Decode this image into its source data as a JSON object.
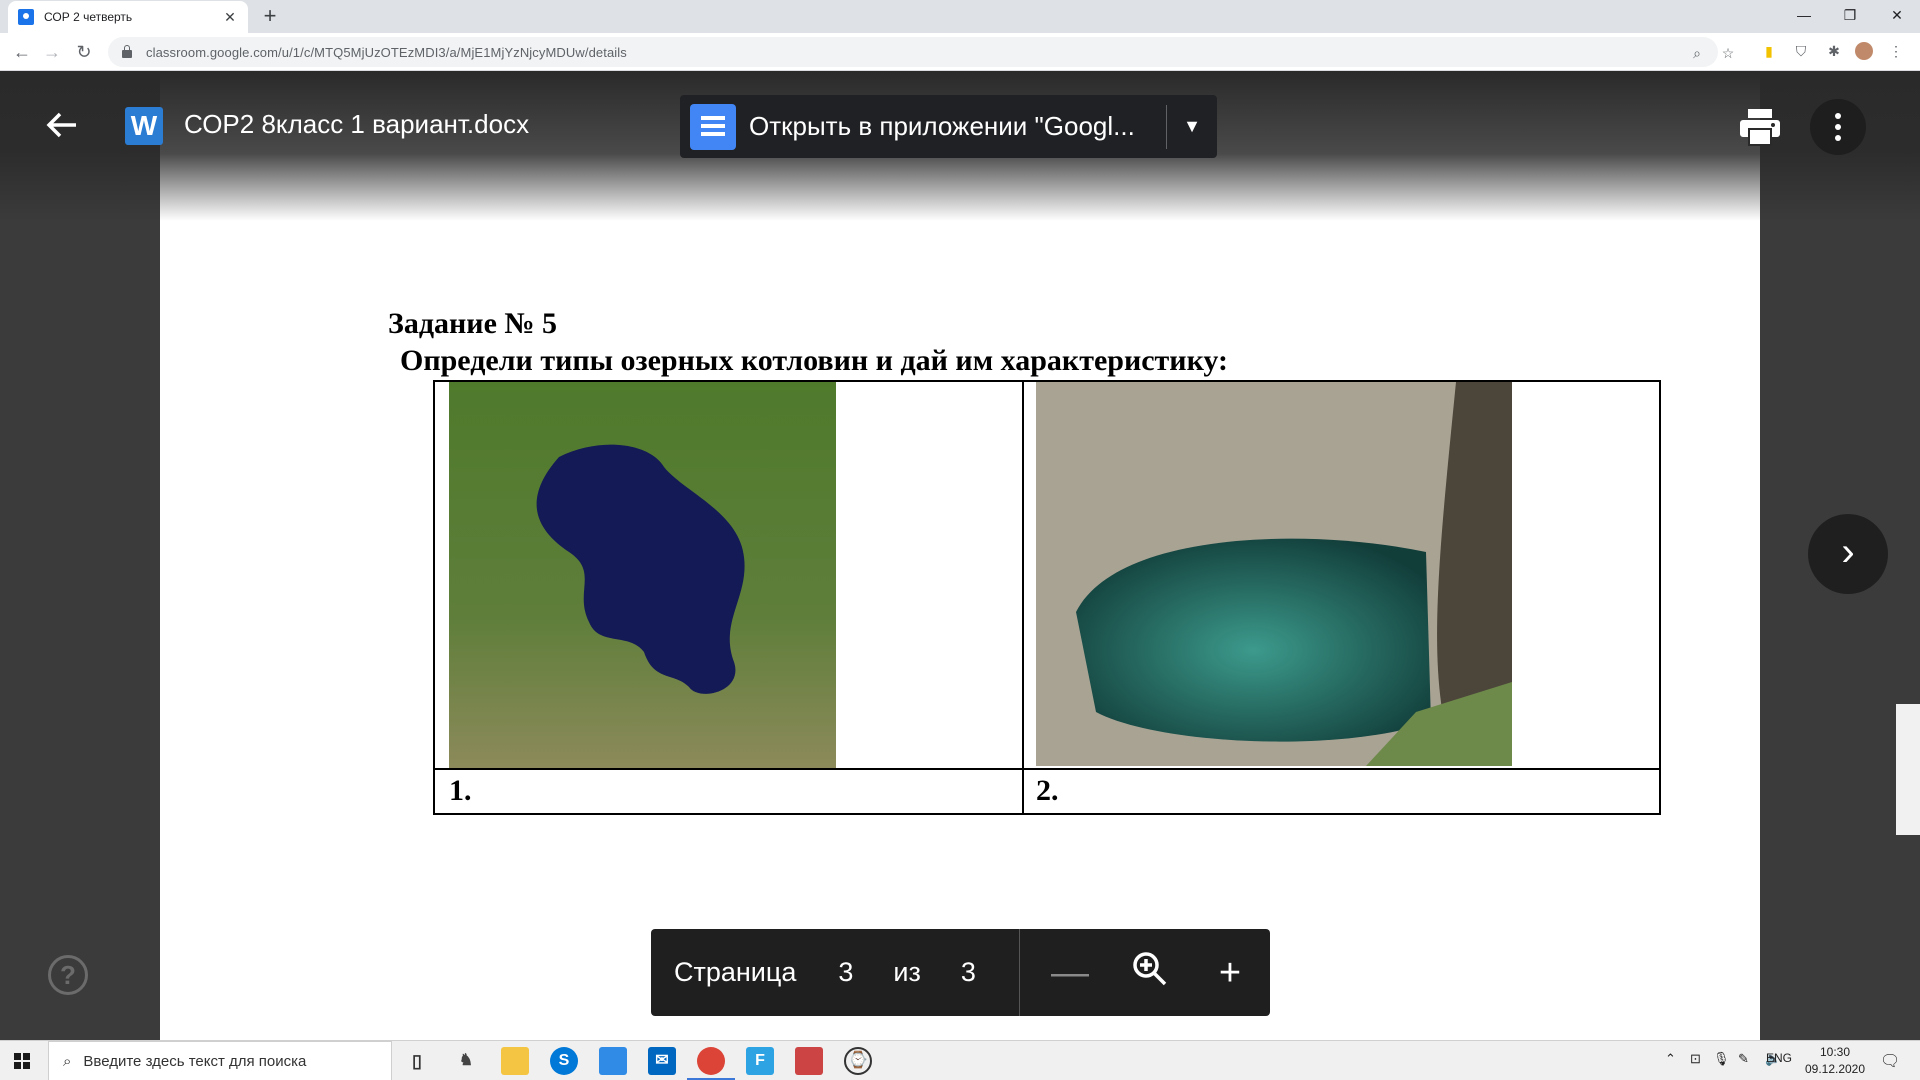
{
  "browser": {
    "tab_title": "СОР 2 четверть",
    "close_glyph": "✕",
    "new_tab_glyph": "+",
    "url": "classroom.google.com/u/1/c/MTQ5MjUzOTEzMDI3/a/MjE1MjYzNjcyMDUw/details"
  },
  "viewer": {
    "file_name": "СОР2 8класс 1 вариант.docx",
    "file_icon_letter": "W",
    "open_in_app_label": "Открыть в приложении \"Googl...",
    "help_glyph": "?",
    "next_glyph": "›"
  },
  "document": {
    "task_title": "Задание № 5",
    "task_text": "Определи типы озерных котловин и дай им характеристику:",
    "label_1": "1.",
    "label_2": "2."
  },
  "pager": {
    "page_word": "Страница",
    "current_page": "3",
    "of_word": "из",
    "total_pages": "3"
  },
  "taskbar": {
    "search_placeholder": "Введите здесь текст для поиска",
    "lang": "ENG",
    "time": "10:30",
    "date": "09.12.2020"
  },
  "icons": {
    "back": "back-arrow-icon",
    "print": "print-icon",
    "more": "more-vert-icon",
    "zoom_out": "minus-icon",
    "zoom": "zoom-icon",
    "zoom_in": "plus-icon"
  },
  "colors": {
    "viewer_bg": "#3b3b3b",
    "toolbar_dark": "#202124",
    "word_blue": "#2b7cd3",
    "gdocs_blue": "#4285f4",
    "chrome_tabstrip": "#dee1e6"
  }
}
